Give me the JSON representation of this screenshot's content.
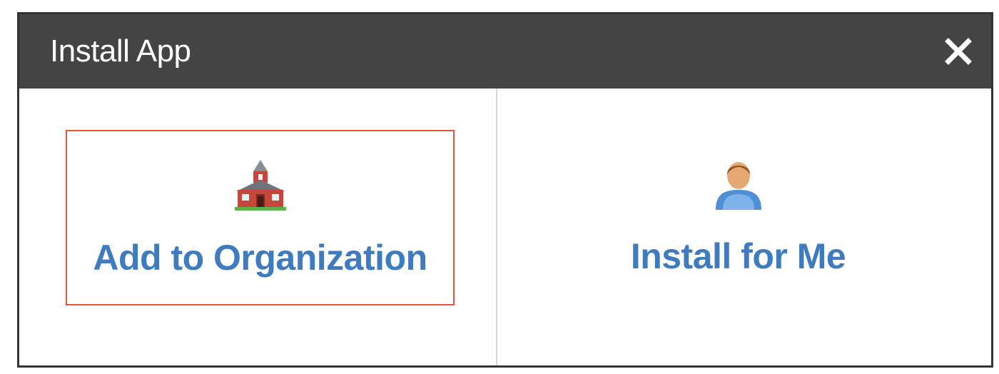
{
  "dialog": {
    "title": "Install App",
    "close_icon": "close-icon"
  },
  "options": [
    {
      "label": "Add to Organization",
      "icon": "school-building-icon",
      "selected": true
    },
    {
      "label": "Install for Me",
      "icon": "user-person-icon",
      "selected": false
    }
  ],
  "colors": {
    "titlebar": "#444444",
    "title_text": "#ffffff",
    "link": "#3f7cbf",
    "selection_border": "#e8553b",
    "divider": "#d6d6d6"
  }
}
